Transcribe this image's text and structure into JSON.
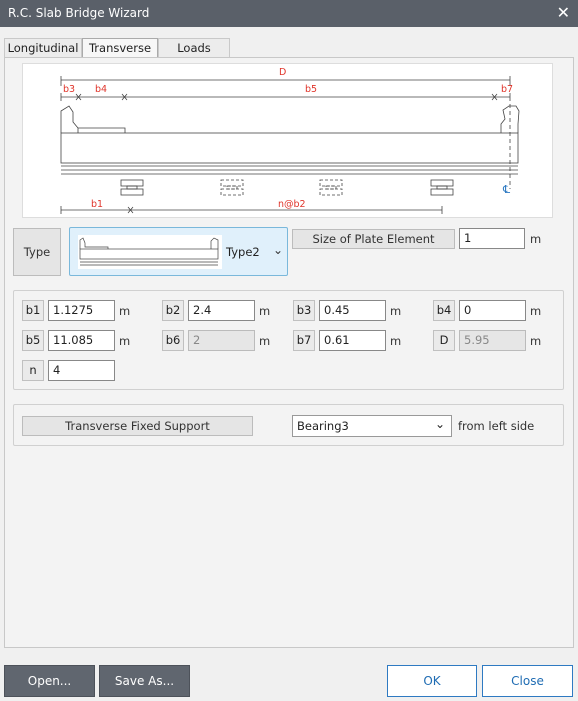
{
  "window": {
    "title": "R.C. Slab Bridge Wizard"
  },
  "tabs": [
    {
      "label": "Longitudinal"
    },
    {
      "label": "Transverse"
    },
    {
      "label": "Loads"
    }
  ],
  "diagram": {
    "labels": {
      "D": "D",
      "b3": "b3",
      "b4": "b4",
      "b5": "b5",
      "b7": "b7",
      "b1": "b1",
      "nb2": "n@b2",
      "cl": "℄"
    }
  },
  "type": {
    "label": "Type",
    "selected": "Type2"
  },
  "plate": {
    "button": "Size of Plate Element",
    "value": "1",
    "unit": "m"
  },
  "params": [
    {
      "tag": "b1",
      "value": "1.1275",
      "unit": "m",
      "disabled": false
    },
    {
      "tag": "b2",
      "value": "2.4",
      "unit": "m",
      "disabled": false
    },
    {
      "tag": "b3",
      "value": "0.45",
      "unit": "m",
      "disabled": false
    },
    {
      "tag": "b4",
      "value": "0",
      "unit": "m",
      "disabled": false
    },
    {
      "tag": "b5",
      "value": "11.085",
      "unit": "m",
      "disabled": false
    },
    {
      "tag": "b6",
      "value": "2",
      "unit": "m",
      "disabled": true
    },
    {
      "tag": "b7",
      "value": "0.61",
      "unit": "m",
      "disabled": false
    },
    {
      "tag": "D",
      "value": "5.95",
      "unit": "m",
      "disabled": true
    },
    {
      "tag": "n",
      "value": "4"
    }
  ],
  "support": {
    "button": "Transverse Fixed Support",
    "selected": "Bearing3",
    "suffix": "from left side"
  },
  "footer": {
    "open": "Open...",
    "save_as": "Save As...",
    "ok": "OK",
    "close": "Close"
  },
  "colors": {
    "accent": "#1f6cb3",
    "dim_label": "#e0352b",
    "titlebar": "#5a6069"
  }
}
